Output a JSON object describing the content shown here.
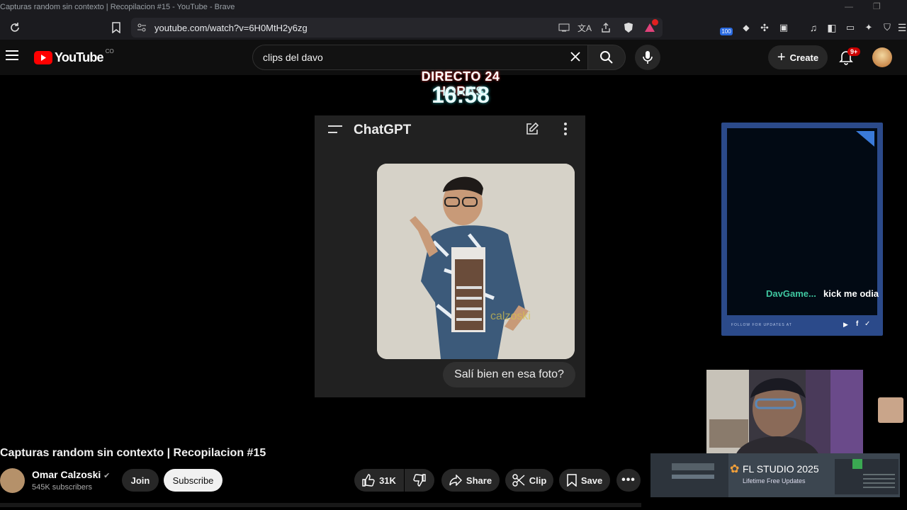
{
  "browser": {
    "window_title": "Capturas random sin contexto | Recopilacion #15 - YouTube - Brave",
    "url": "youtube.com/watch?v=6H0MtH2y6zg",
    "extension_badge": "100"
  },
  "youtube": {
    "logo_text": "YouTube",
    "logo_suffix": "CO",
    "search_query": "clips del davo",
    "create_label": "Create",
    "notifications_badge": "9+"
  },
  "video_overlay": {
    "live_label": "DIRECTO 24 HORAS",
    "live_time": "16:58",
    "chat_app_title": "ChatGPT",
    "photo_watermark": "calzoski",
    "message_bubble": "Salí bien en esa foto?",
    "stream_chat_user": "DavGame...",
    "stream_chat_text": "kick me odia",
    "follow_text": "FOLLOW FOR UPDATES AT",
    "ad_title": "FL STUDIO 2025",
    "ad_subtitle": "Lifetime Free Updates"
  },
  "video_info": {
    "title": "Capturas random sin contexto | Recopilacion #15",
    "channel_name": "Omar Calzoski",
    "subscribers": "545K subscribers",
    "join_label": "Join",
    "subscribe_label": "Subscribe",
    "likes": "31K",
    "share_label": "Share",
    "clip_label": "Clip",
    "save_label": "Save"
  },
  "colors": {
    "youtube_red": "#ff0000",
    "live_time_glow": "#2aa",
    "overlay_border": "#2b4a8a",
    "stream_user_color": "#3fc7a0"
  }
}
